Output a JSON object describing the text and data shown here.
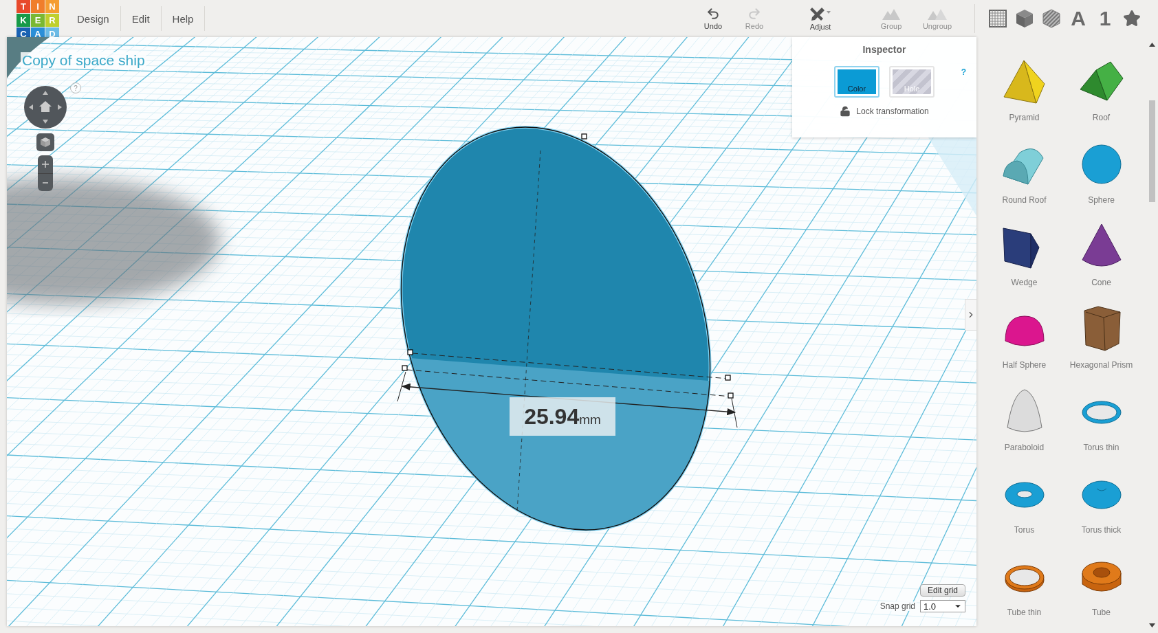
{
  "logo": {
    "tiles": [
      {
        "letter": "T",
        "color": "#e8492b"
      },
      {
        "letter": "I",
        "color": "#f07e2b"
      },
      {
        "letter": "N",
        "color": "#f59d31"
      },
      {
        "letter": "K",
        "color": "#179a48"
      },
      {
        "letter": "E",
        "color": "#7ab833"
      },
      {
        "letter": "R",
        "color": "#bfcf2d"
      },
      {
        "letter": "C",
        "color": "#1a62b3"
      },
      {
        "letter": "A",
        "color": "#2b8fd8"
      },
      {
        "letter": "D",
        "color": "#6cbbe6"
      }
    ]
  },
  "menu": [
    {
      "label": "Design"
    },
    {
      "label": "Edit"
    },
    {
      "label": "Help"
    }
  ],
  "toolbar": [
    {
      "kind": "undo",
      "label": "Undo",
      "disabled": false
    },
    {
      "kind": "redo",
      "label": "Redo",
      "disabled": true
    },
    {
      "kind": "adjust",
      "label": "Adjust",
      "disabled": false
    },
    {
      "kind": "group",
      "label": "Group",
      "disabled": true
    },
    {
      "kind": "ungroup",
      "label": "Ungroup",
      "disabled": true
    }
  ],
  "categories": [
    {
      "kind": "grid"
    },
    {
      "kind": "cube"
    },
    {
      "kind": "hole"
    },
    {
      "kind": "text",
      "label": "A"
    },
    {
      "kind": "text",
      "label": "1"
    },
    {
      "kind": "star"
    }
  ],
  "design": {
    "title": "Copy of space ship",
    "help": "?",
    "dimension": {
      "value": "25.94",
      "unit": "mm"
    }
  },
  "inspector": {
    "title": "Inspector",
    "modes": [
      {
        "kind": "color",
        "label": "Color",
        "selected": true
      },
      {
        "kind": "hole",
        "label": "Hole",
        "selected": false
      }
    ],
    "help": "?",
    "lock": {
      "label": "Lock transformation",
      "locked": false
    }
  },
  "grid_controls": {
    "edit_button": "Edit grid",
    "snap_label": "Snap grid",
    "snap_value": "1.0"
  },
  "shapes": [
    {
      "kind": "pyramid",
      "name": "Pyramid"
    },
    {
      "kind": "roof",
      "name": "Roof"
    },
    {
      "kind": "round_roof",
      "name": "Round Roof"
    },
    {
      "kind": "sphere",
      "name": "Sphere"
    },
    {
      "kind": "wedge",
      "name": "Wedge"
    },
    {
      "kind": "cone",
      "name": "Cone"
    },
    {
      "kind": "half_sphere",
      "name": "Half Sphere"
    },
    {
      "kind": "hex_prism",
      "name": "Hexagonal Prism"
    },
    {
      "kind": "paraboloid",
      "name": "Paraboloid"
    },
    {
      "kind": "torus_thin",
      "name": "Torus thin"
    },
    {
      "kind": "torus",
      "name": "Torus"
    },
    {
      "kind": "torus_thick",
      "name": "Torus thick"
    },
    {
      "kind": "tube_thin",
      "name": "Tube thin"
    },
    {
      "kind": "tube",
      "name": "Tube"
    }
  ]
}
